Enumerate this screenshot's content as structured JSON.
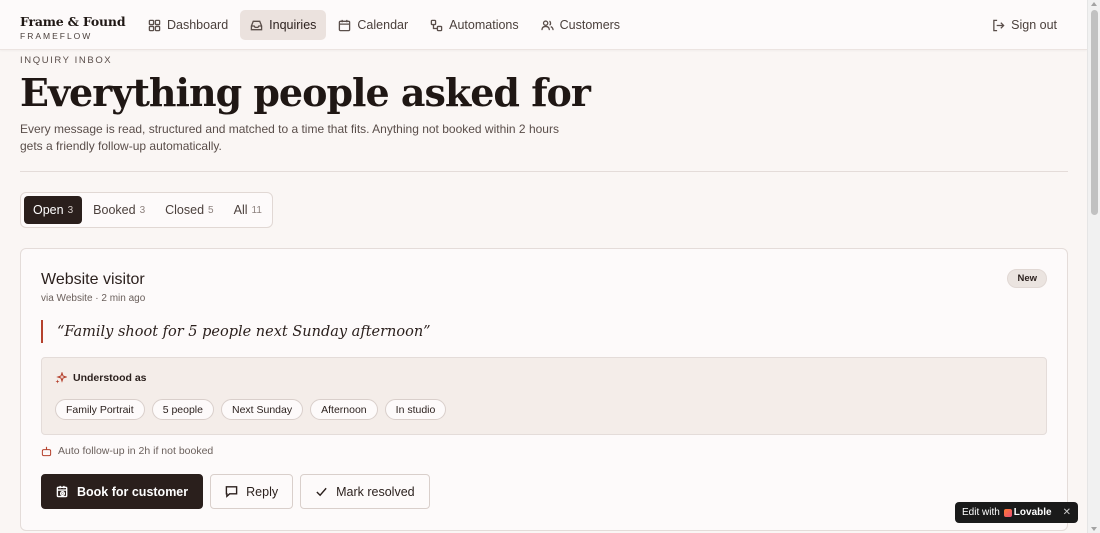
{
  "brand": {
    "name": "Frame & Found",
    "sub": "FRAMEFLOW"
  },
  "nav": {
    "items": [
      {
        "label": "Dashboard",
        "icon": "grid-icon"
      },
      {
        "label": "Inquiries",
        "icon": "inbox-icon",
        "active": true
      },
      {
        "label": "Calendar",
        "icon": "calendar-icon"
      },
      {
        "label": "Automations",
        "icon": "workflow-icon"
      },
      {
        "label": "Customers",
        "icon": "users-icon"
      }
    ],
    "signout": "Sign out"
  },
  "page": {
    "eyebrow": "INQUIRY INBOX",
    "title": "Everything people asked for",
    "description": "Every message is read, structured and matched to a time that fits. Anything not booked within 2 hours gets a friendly follow-up automatically."
  },
  "tabs": [
    {
      "label": "Open",
      "count": "3",
      "active": true
    },
    {
      "label": "Booked",
      "count": "3"
    },
    {
      "label": "Closed",
      "count": "5"
    },
    {
      "label": "All",
      "count": "11"
    }
  ],
  "inquiry": {
    "title": "Website visitor",
    "meta": "via Website · 2 min ago",
    "badge": "New",
    "quote": "“Family shoot for 5 people next Sunday afternoon”",
    "understood_label": "Understood as",
    "chips": [
      "Family Portrait",
      "5 people",
      "Next Sunday",
      "Afternoon",
      "In studio"
    ],
    "followup": "Auto follow-up in 2h if not booked",
    "actions": {
      "book": "Book for customer",
      "reply": "Reply",
      "resolve": "Mark resolved"
    }
  },
  "lovable": {
    "prefix": "Edit with",
    "brand": "Lovable"
  },
  "colors": {
    "accent": "#2a1f1c",
    "quote_bar": "#b5412d",
    "background": "#faf6f4"
  }
}
